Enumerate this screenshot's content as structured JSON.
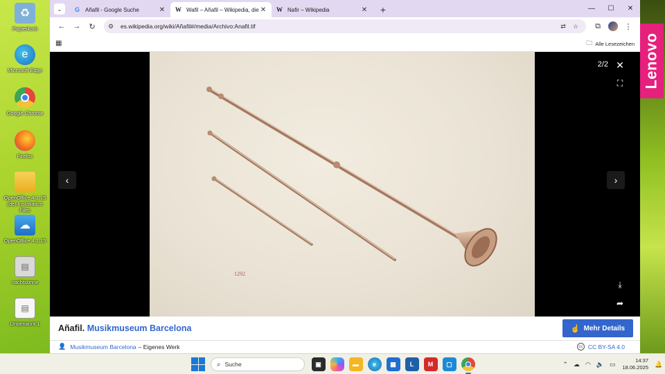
{
  "desktop": {
    "icons": [
      {
        "label": "Papierkorb",
        "icon": "recycle-bin-icon",
        "color": "#7fb0d9",
        "glyph": "♻"
      },
      {
        "label": "Microsoft Edge",
        "icon": "edge-icon",
        "color": "#1f8fd6",
        "glyph": "e"
      },
      {
        "label": "Google Chrome",
        "icon": "chrome-icon",
        "color": "#e7463a",
        "glyph": "●"
      },
      {
        "label": "Firefox",
        "icon": "firefox-icon",
        "color": "#f06a1d",
        "glyph": "🦊"
      },
      {
        "label": "OpenOffice 4.1.15 (de) Installation Files",
        "icon": "folder-icon",
        "color": "#f4c237",
        "glyph": "▬"
      },
      {
        "label": "OpenOffice 4.1.15",
        "icon": "openoffice-icon",
        "color": "#2f8fd8",
        "glyph": "☁"
      },
      {
        "label": "nachtsonne",
        "icon": "document-icon",
        "color": "#d7d7d7",
        "glyph": "▤"
      },
      {
        "label": "Unbenannt 1",
        "icon": "document-icon",
        "color": "#f4f4f4",
        "glyph": "▤"
      }
    ],
    "brand": "Lenovo",
    "brand_color": "#e6207d"
  },
  "browser": {
    "tabs": [
      {
        "title": "Añafil - Google Suche",
        "favicon": "G",
        "active": false
      },
      {
        "title": "Wafil – Añafil – Wikipedia, die f",
        "favicon": "W",
        "active": true
      },
      {
        "title": "Nafir – Wikipedia",
        "favicon": "W",
        "active": false
      }
    ],
    "new_tab": "+",
    "url": "es.wikipedia.org/wiki/Añafil#/media/Archivo:Anafil.tif",
    "bookmarks_label": "Alle Lesezeichen"
  },
  "viewer": {
    "counter": "2/2",
    "image_label": "1292",
    "caption": {
      "title": "Añafil.",
      "title_link": "Musikmuseum Barcelona",
      "more_details": "Mehr Details",
      "author_link": "Musikmuseum Barcelona",
      "author_suffix": "– Eigenes Werk",
      "license": "CC BY-SA 4.0"
    }
  },
  "taskbar": {
    "search_placeholder": "Suche",
    "time": "14:37",
    "date": "18.06.2025"
  }
}
